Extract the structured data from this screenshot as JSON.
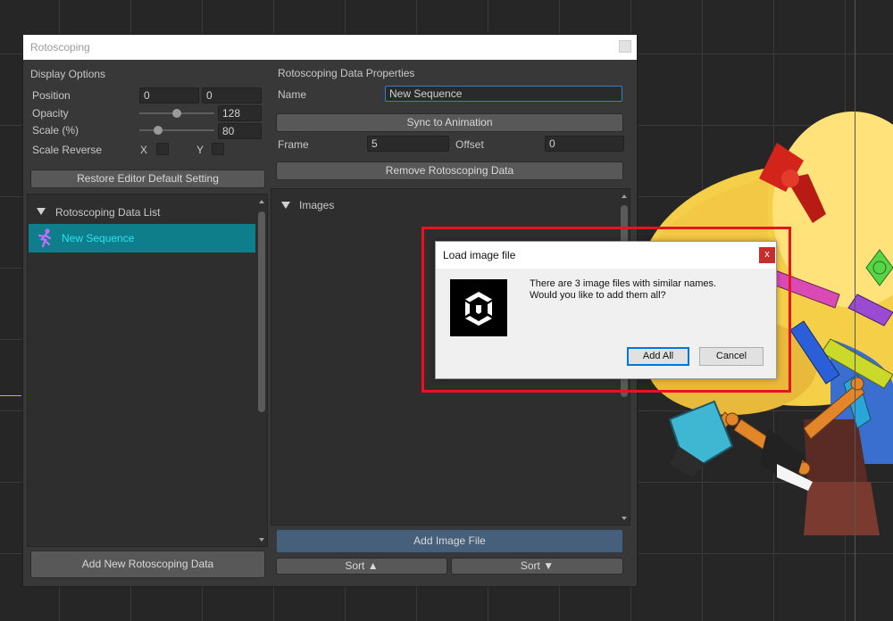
{
  "window": {
    "title": "Rotoscoping"
  },
  "display_options": {
    "header": "Display Options",
    "position_label": "Position",
    "position_x": "0",
    "position_y": "0",
    "opacity_label": "Opacity",
    "opacity_value": "128",
    "opacity_fraction": 0.5,
    "scale_label": "Scale (%)",
    "scale_value": "80",
    "scale_fraction": 0.25,
    "scale_reverse_label": "Scale Reverse",
    "x_label": "X",
    "y_label": "Y",
    "restore_button": "Restore Editor Default Setting"
  },
  "data_list": {
    "header": "Rotoscoping Data List",
    "items": [
      "New Sequence"
    ],
    "add_button": "Add New Rotoscoping Data"
  },
  "properties": {
    "header": "Rotoscoping Data Properties",
    "name_label": "Name",
    "name_value": "New Sequence",
    "sync_button": "Sync to Animation",
    "frame_label": "Frame",
    "frame_value": "5",
    "offset_label": "Offset",
    "offset_value": "0",
    "remove_button": "Remove Rotoscoping Data",
    "images_header": "Images",
    "add_image_button": "Add Image File",
    "sort_asc_button": "Sort",
    "sort_desc_button": "Sort"
  },
  "dialog": {
    "title": "Load image file",
    "close": "x",
    "message_line1": "There are 3 image files with similar names.",
    "message_line2": "Would you like to add them all?",
    "add_all_button": "Add All",
    "cancel_button": "Cancel",
    "icon": "unity-logo-icon"
  },
  "colors": {
    "accent_selected": "#0e7e8b",
    "selected_text": "#2ee0f2",
    "highlight_box": "#e8131f",
    "button_blue": "#46607c"
  }
}
